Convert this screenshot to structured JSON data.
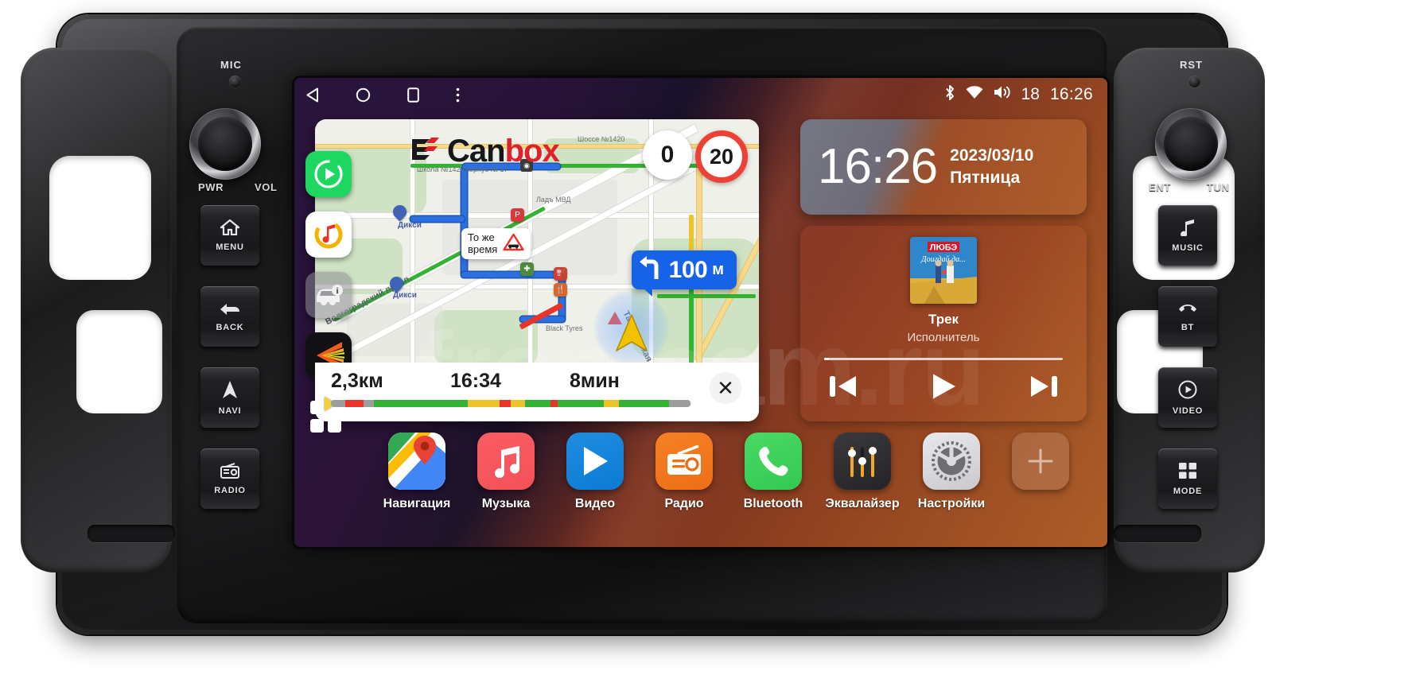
{
  "device": {
    "brand_logo": {
      "text_dark": "Can",
      "text_red": "box"
    },
    "labels": {
      "mic": "MIC",
      "rst": "RST",
      "pwr": "PWR",
      "vol": "VOL",
      "ent": "ENT",
      "tun": "TUN"
    },
    "left_buttons": [
      {
        "icon": "home-icon",
        "label": "MENU"
      },
      {
        "icon": "back-arrow-icon",
        "label": "BACK"
      },
      {
        "icon": "navi-arrow-icon",
        "label": "NAVI"
      },
      {
        "icon": "radio-icon",
        "label": "RADIO"
      }
    ],
    "right_buttons": [
      {
        "icon": "music-note-icon",
        "label": "MUSIC"
      },
      {
        "icon": "phone-handset-icon",
        "label": "BT"
      },
      {
        "icon": "play-circle-icon",
        "label": "VIDEO"
      },
      {
        "icon": "grid-icon",
        "label": "MODE"
      }
    ]
  },
  "statusbar": {
    "nav_keys": [
      "back-triangle-icon",
      "home-circle-icon",
      "recents-square-icon",
      "overflow-menu-icon"
    ],
    "bluetooth_icon": "bluetooth-icon",
    "wifi_icon": "wifi-icon",
    "volume_icon": "speaker-icon",
    "volume_value": "18",
    "clock": "16:26"
  },
  "map": {
    "watermark": "frontcam.ru",
    "speed_current": "0",
    "speed_limit": "20",
    "callout": {
      "line1": "То же",
      "line2": "время",
      "icon": "traffic-jam-warning-icon"
    },
    "maneuver": {
      "icon": "turn-left-icon",
      "distance": "100",
      "unit": "м"
    },
    "route": {
      "distance": "2,3км",
      "eta": "16:34",
      "duration": "8мин",
      "close_icon": "close-icon"
    },
    "street_labels": [
      "Волгоградский просп.",
      "Ташкентская",
      "Шоссе №1420",
      "Школа №1420 корпус № 17",
      "Дикси",
      "Дикси",
      "Ладъ МВД",
      "Black Tyres"
    ],
    "traffic_segments": [
      {
        "color": "#9d9d9d",
        "pct": 4
      },
      {
        "color": "#e8342a",
        "pct": 5
      },
      {
        "color": "#9d9d9d",
        "pct": 3
      },
      {
        "color": "#34b233",
        "pct": 26
      },
      {
        "color": "#ecc42a",
        "pct": 9
      },
      {
        "color": "#e8342a",
        "pct": 3
      },
      {
        "color": "#ecc42a",
        "pct": 4
      },
      {
        "color": "#34b233",
        "pct": 7
      },
      {
        "color": "#e8342a",
        "pct": 2
      },
      {
        "color": "#34b233",
        "pct": 13
      },
      {
        "color": "#ecc42a",
        "pct": 4
      },
      {
        "color": "#34b233",
        "pct": 14
      },
      {
        "color": "#9d9d9d",
        "pct": 6
      }
    ]
  },
  "clock_widget": {
    "time": "16:26",
    "date": "2023/03/10",
    "weekday": "Пятница"
  },
  "music_widget": {
    "album_art": "lyube-album-cover",
    "track": "Трек",
    "artist": "Исполнитель",
    "prev_icon": "skip-previous-icon",
    "play_icon": "play-icon",
    "next_icon": "skip-next-icon"
  },
  "icon_rail": [
    {
      "name": "player-green-icon"
    },
    {
      "name": "yandex-music-icon"
    },
    {
      "name": "car-info-icon"
    },
    {
      "name": "kaspersky-icon"
    },
    {
      "name": "all-apps-icon"
    }
  ],
  "dock": [
    {
      "name": "navigation-app",
      "label": "Навигация",
      "icon": "maps-pin-icon"
    },
    {
      "name": "music-app",
      "label": "Музыка",
      "icon": "music-note-icon"
    },
    {
      "name": "video-app",
      "label": "Видео",
      "icon": "play-triangle-icon"
    },
    {
      "name": "radio-app",
      "label": "Радио",
      "icon": "radio-icon"
    },
    {
      "name": "bluetooth-app",
      "label": "Bluetooth",
      "icon": "phone-handset-icon"
    },
    {
      "name": "equalizer-app",
      "label": "Эквалайзер",
      "icon": "sliders-icon"
    },
    {
      "name": "settings-app",
      "label": "Настройки",
      "icon": "gear-icon"
    },
    {
      "name": "add-shortcut",
      "label": "",
      "icon": "plus-icon"
    }
  ],
  "colors": {
    "accent_red": "#e0202a",
    "speed_limit_ring": "#ee4136",
    "maneuver_blue": "#1663e8",
    "route_blue": "#2b6fe0",
    "traffic_green": "#34b233",
    "traffic_yellow": "#ecc42a",
    "traffic_red": "#e8342a"
  }
}
